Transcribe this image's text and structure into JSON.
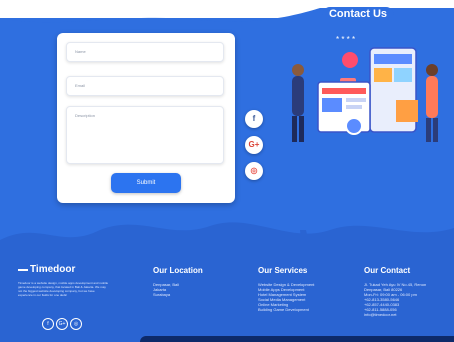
{
  "header": {
    "title": "Contact Us"
  },
  "form": {
    "name_placeholder": "Name",
    "email_placeholder": "Email",
    "description_placeholder": "Description",
    "submit_label": "Submit"
  },
  "social": {
    "facebook": "f",
    "google": "G+",
    "instagram": "◎"
  },
  "footer": {
    "brand": "Timedoor",
    "description": "Timedoor is a website design, mobile apps development and mobile game developing company, that located in Bali & Jakarta. We may not the biggest website developing company, but we have experience in our fields for one dedic",
    "social": [
      "f",
      "G+",
      "◎"
    ],
    "location": {
      "heading": "Our Location",
      "items": [
        "Denpasar, Bali",
        "Jakarta",
        "Surabaya"
      ]
    },
    "services": {
      "heading": "Our Services",
      "items": [
        "Website Design & Development",
        "Mobile Apps Development",
        "Hotel Management System",
        "Social Media Management",
        "Online Marketing",
        "Building Game Development"
      ]
    },
    "contact": {
      "heading": "Our Contact",
      "items": [
        "Jl. Tukad Yeh Ayu IV No.45, Renon",
        "Denpasar, Bali 80226",
        "Mon-Fri: 09:00 am - 06:00 pm",
        "+62-813-3580-5646",
        "+62-857-4440-0383",
        "+62-811-5888-056",
        "info@timedoor.net"
      ]
    }
  },
  "colors": {
    "primary": "#2f6fe0",
    "footer": "#2a64d2",
    "button": "#2c74f0"
  }
}
